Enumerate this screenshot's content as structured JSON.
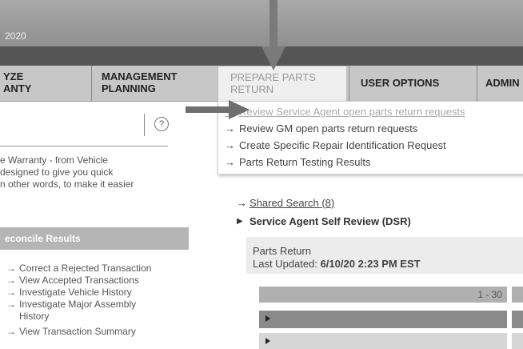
{
  "header": {
    "year_text": "2020"
  },
  "nav": {
    "tabs": [
      {
        "line1": "YZE",
        "line2": "ANTY"
      },
      {
        "line1": "MANAGEMENT",
        "line2": "PLANNING"
      },
      {
        "line1": "PREPARE PARTS",
        "line2": "RETURN"
      },
      {
        "line1": "USER OPTIONS",
        "line2": ""
      },
      {
        "line1": "ADMIN",
        "line2": ""
      }
    ]
  },
  "dropdown": {
    "arrow": "→",
    "items": [
      "Review Service Agent open parts return requests",
      "Review GM open parts return requests",
      "Create Specific Repair Identification Request",
      "Parts Return Testing Results"
    ]
  },
  "left": {
    "help_icon": "?",
    "intro": [
      "e Warranty - from Vehicle",
      "designed to give you quick",
      "n other words, to make it easier"
    ],
    "panel_title": "econcile Results",
    "arrow": "→",
    "links": [
      "Correct a Rejected Transaction",
      "View Accepted Transactions",
      "Investigate Vehicle History",
      "Investigate Major Assembly History",
      "View Transaction Summary"
    ]
  },
  "main": {
    "arrow": "→",
    "triangle": "▶",
    "shared_search": "Shared Search (8)",
    "self_review": "Service Agent Self Review (DSR)",
    "card_title": "Parts Return",
    "last_updated_label": "Last Updated:",
    "last_updated_value": "6/10/20 2:23 PM EST",
    "pager": "1 - 30"
  },
  "annotation_arrows": [
    "down-arrow",
    "right-arrow"
  ]
}
